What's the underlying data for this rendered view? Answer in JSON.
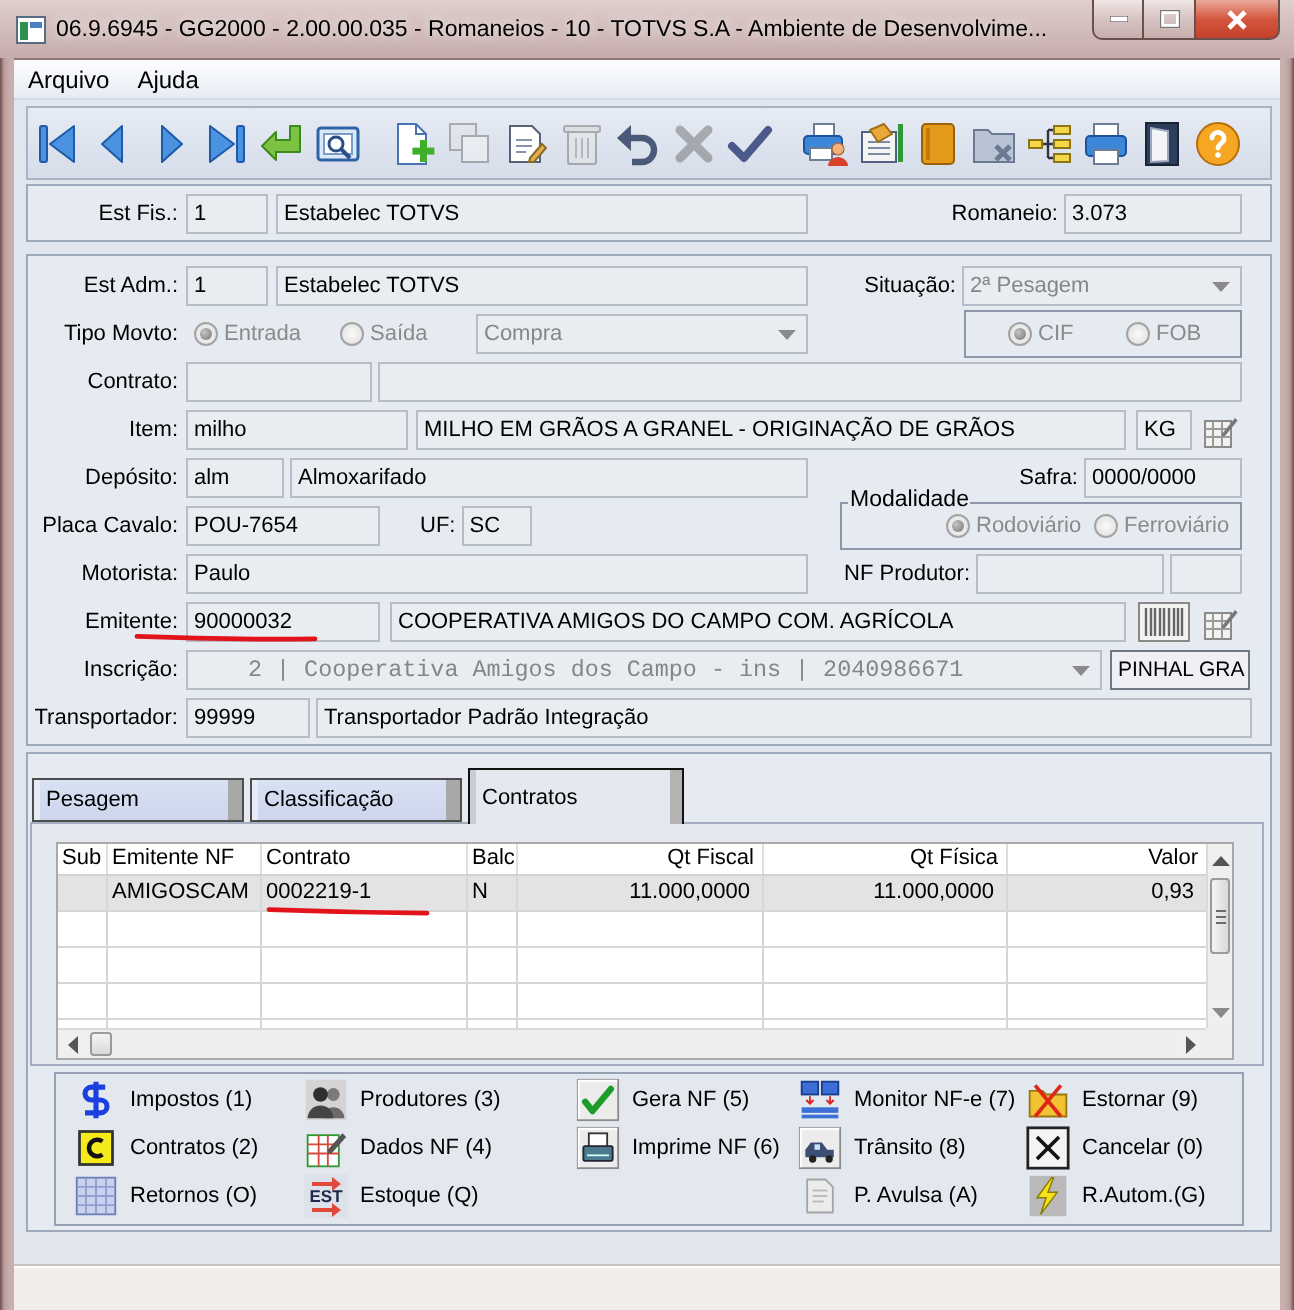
{
  "window": {
    "title": "06.9.6945 - GG2000 - 2.00.00.035 - Romaneios - 10 - TOTVS S.A - Ambiente de Desenvolvime..."
  },
  "menu": [
    {
      "label": "Arquivo"
    },
    {
      "label": "Ajuda"
    }
  ],
  "toolbar": [
    [
      {
        "kind": "first",
        "disabled": false
      },
      {
        "kind": "previous",
        "disabled": false
      },
      {
        "kind": "next",
        "disabled": false
      },
      {
        "kind": "last",
        "disabled": false
      },
      {
        "kind": "enter",
        "disabled": false
      },
      {
        "kind": "preview",
        "disabled": false
      }
    ],
    [
      {
        "kind": "new",
        "disabled": false
      },
      {
        "kind": "copy",
        "disabled": true
      },
      {
        "kind": "edit",
        "disabled": false
      },
      {
        "kind": "delete",
        "disabled": true
      },
      {
        "kind": "undo",
        "disabled": false
      },
      {
        "kind": "cancel",
        "disabled": true
      },
      {
        "kind": "save",
        "disabled": false
      }
    ],
    [
      {
        "kind": "report",
        "disabled": false
      },
      {
        "kind": "handover",
        "disabled": false
      },
      {
        "kind": "book",
        "disabled": false
      },
      {
        "kind": "folderdelete",
        "disabled": false
      },
      {
        "kind": "tree",
        "disabled": false
      },
      {
        "kind": "print",
        "disabled": false
      },
      {
        "kind": "exit",
        "disabled": false
      },
      {
        "kind": "help",
        "disabled": false
      }
    ]
  ],
  "header": {
    "est_fis": {
      "label": "Est Fis.:",
      "code": "1",
      "name": "Estabelec TOTVS"
    },
    "romaneio": {
      "label": "Romaneio:",
      "value": "3.073"
    }
  },
  "form": {
    "est_adm": {
      "label": "Est Adm.:",
      "code": "1",
      "name": "Estabelec TOTVS"
    },
    "situacao": {
      "label": "Situação:",
      "value": "2ª Pesagem"
    },
    "tipo_movto": {
      "label": "Tipo Movto:",
      "options": [
        {
          "label": "Entrada",
          "selected": true
        },
        {
          "label": "Saída",
          "selected": false
        }
      ],
      "operation": "Compra"
    },
    "frete": {
      "options": [
        {
          "label": "CIF",
          "selected": true
        },
        {
          "label": "FOB",
          "selected": false
        }
      ]
    },
    "contrato": {
      "label": "Contrato:"
    },
    "item": {
      "label": "Item:",
      "code": "milho",
      "name": "MILHO EM GRÃOS A GRANEL - ORIGINAÇÃO DE GRÃOS",
      "unit": "KG"
    },
    "deposito": {
      "label": "Depósito:",
      "code": "alm",
      "name": "Almoxarifado"
    },
    "safra": {
      "label": "Safra:",
      "value": "0000/0000"
    },
    "placa_cavalo": {
      "label": "Placa Cavalo:",
      "value": "POU-7654"
    },
    "uf": {
      "label": "UF:",
      "value": "SC"
    },
    "modalidade": {
      "title": "Modalidade",
      "options": [
        {
          "label": "Rodoviário",
          "selected": true
        },
        {
          "label": "Ferroviário",
          "selected": false
        }
      ]
    },
    "motorista": {
      "label": "Motorista:",
      "value": "Paulo"
    },
    "nf_produtor": {
      "label": "NF Produtor:"
    },
    "emitente": {
      "label": "Emitente:",
      "code": "90000032",
      "name": "COOPERATIVA AMIGOS DO CAMPO COM. AGRÍCOLA",
      "underlined": true
    },
    "inscricao": {
      "label": "Inscrição:",
      "value": "2 | Cooperativa Amigos dos Campo - ins | 2040986671",
      "city": "PINHAL GRA"
    },
    "transportador": {
      "label": "Transportador:",
      "code": "99999",
      "name": "Transportador Padrão Integração"
    }
  },
  "tabs": [
    {
      "label": "Pesagem",
      "selected": false
    },
    {
      "label": "Classificação",
      "selected": false
    },
    {
      "label": "Contratos",
      "selected": true
    }
  ],
  "table": {
    "columns": [
      "Sub",
      "Emitente NF",
      "Contrato",
      "Balc",
      "Qt Fiscal",
      "Qt Física",
      "Valor"
    ],
    "rows": [
      {
        "selected": true,
        "emitente_nf": "AMIGOSCAM",
        "contrato": "0002219-1",
        "contrato_underlined": true,
        "balc": "N",
        "qt_fiscal": "11.000,0000",
        "qt_fisica": "11.000,0000",
        "valor": "0,93"
      }
    ]
  },
  "actions": [
    [
      {
        "label": "Impostos (1)",
        "kind": "taxes"
      },
      {
        "label": "Contratos (2)",
        "kind": "contracts"
      },
      {
        "label": "Retornos (O)",
        "kind": "returns"
      }
    ],
    [
      {
        "label": "Produtores (3)",
        "kind": "producers"
      },
      {
        "label": "Dados NF (4)",
        "kind": "invoicedata"
      },
      {
        "label": "Estoque (Q)",
        "kind": "stock",
        "icon_text": "EST"
      }
    ],
    [
      {
        "label": "Gera NF (5)",
        "kind": "generate"
      },
      {
        "label": "Imprime NF (6)",
        "kind": "print"
      }
    ],
    [
      {
        "label": "Monitor NF-e (7)",
        "kind": "monitor"
      },
      {
        "label": "Trânsito (8)",
        "kind": "transit"
      },
      {
        "label": "P. Avulsa (A)",
        "kind": "loose"
      }
    ],
    [
      {
        "label": "Estornar (9)",
        "kind": "reverse"
      },
      {
        "label": "Cancelar (0)",
        "kind": "cancel"
      },
      {
        "label": "R.Autom.(G)",
        "kind": "auto"
      }
    ]
  ]
}
